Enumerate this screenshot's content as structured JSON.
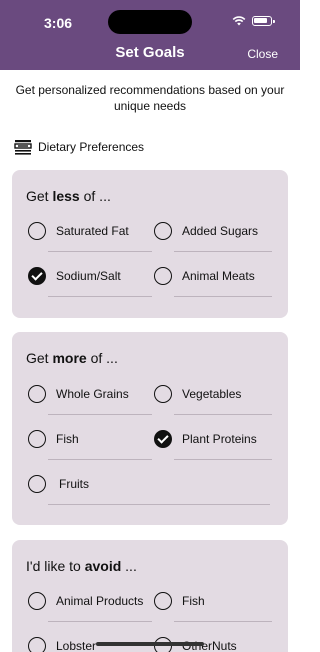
{
  "status": {
    "time": "3:06"
  },
  "header": {
    "title": "Set Goals",
    "close_label": "Close"
  },
  "intro": "Get personalized recommendations based on your unique needs",
  "section": {
    "label": "Dietary Preferences",
    "icon": "dietary-icon"
  },
  "cards": [
    {
      "title_prefix": "Get ",
      "title_bold": "less",
      "title_suffix": " of ...",
      "options": [
        {
          "label": "Saturated Fat",
          "checked": false
        },
        {
          "label": "Added Sugars",
          "checked": false
        },
        {
          "label": "Sodium/Salt",
          "checked": true
        },
        {
          "label": "Animal Meats",
          "checked": false
        }
      ]
    },
    {
      "title_prefix": "Get ",
      "title_bold": "more",
      "title_suffix": " of ...",
      "options": [
        {
          "label": "Whole Grains",
          "checked": false
        },
        {
          "label": "Vegetables",
          "checked": false
        },
        {
          "label": "Fish",
          "checked": false
        },
        {
          "label": "Plant Proteins",
          "checked": true
        },
        {
          "label": "Fruits",
          "checked": false
        }
      ]
    },
    {
      "title_prefix": "I'd like to ",
      "title_bold": "avoid",
      "title_suffix": " ...",
      "options": [
        {
          "label": "Animal Products",
          "checked": false
        },
        {
          "label": "Fish",
          "checked": false
        },
        {
          "label": "Lobster",
          "checked": false
        },
        {
          "label": "OtherNuts",
          "checked": false
        }
      ]
    }
  ],
  "colors": {
    "header": "#6a4a7f",
    "card": "#e3dbe3",
    "checked": "#111111"
  }
}
